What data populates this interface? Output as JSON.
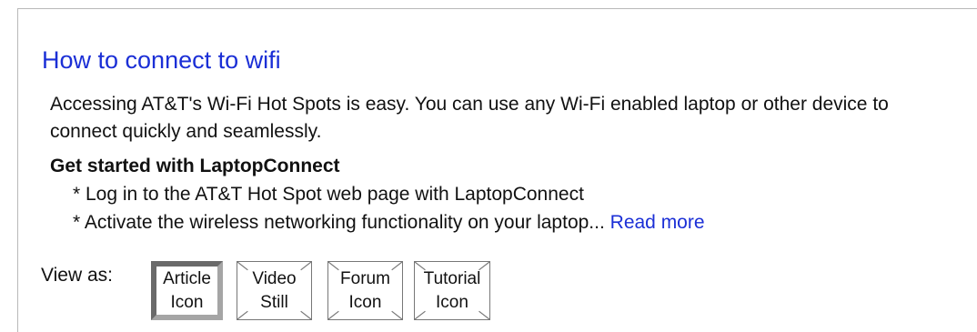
{
  "article": {
    "title": "How to connect to wifi",
    "description": "Accessing AT&T's Wi-Fi Hot Spots is easy. You can use any Wi-Fi enabled laptop or other device to connect quickly and seamlessly.",
    "heading": "Get started with LaptopConnect",
    "bullets": [
      "* Log in to the AT&T Hot Spot web page with LaptopConnect",
      "* Activate the wireless networking functionality on your laptop..."
    ],
    "read_more": "Read more"
  },
  "view_as": {
    "label": "View as:",
    "options": [
      {
        "line1": "Article",
        "line2": "Icon",
        "selected": true
      },
      {
        "line1": "Video",
        "line2": "Still",
        "selected": false
      },
      {
        "line1": "Forum",
        "line2": "Icon",
        "selected": false
      },
      {
        "line1": "Tutorial",
        "line2": "Icon",
        "selected": false
      }
    ]
  },
  "colors": {
    "link": "#1b2fd6",
    "selected_border": "#8a8a8a"
  }
}
